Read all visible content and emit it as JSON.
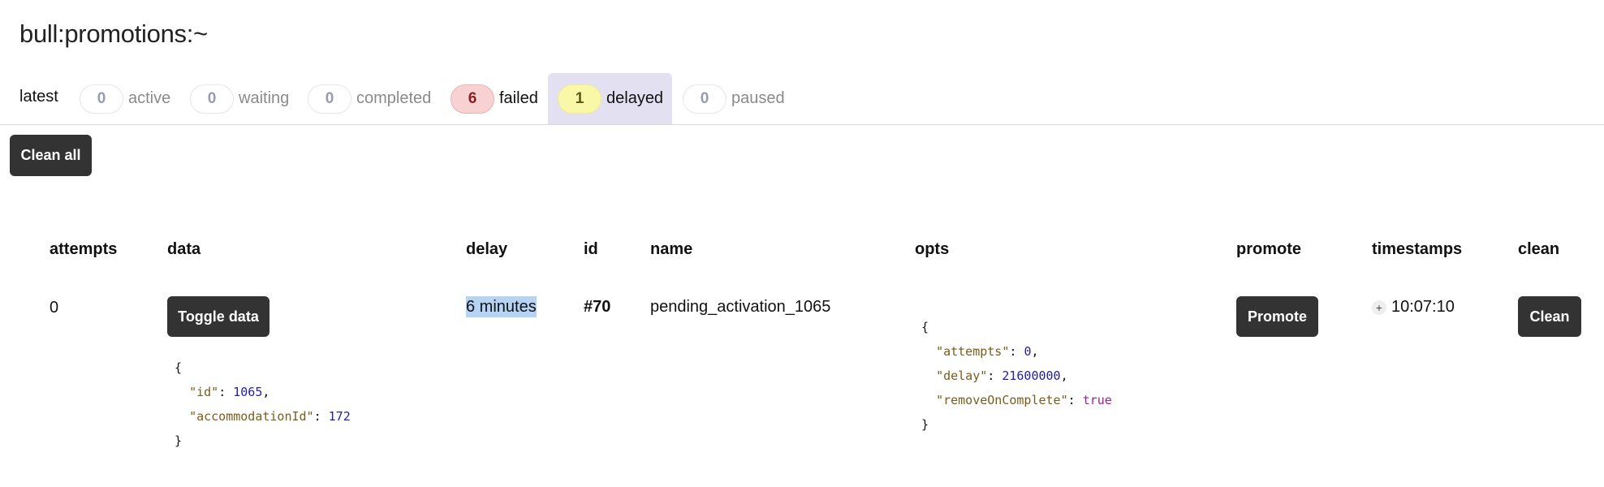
{
  "queue": {
    "title": "bull:promotions:~"
  },
  "tabs": {
    "latest": "latest",
    "active": {
      "count": "0",
      "label": "active"
    },
    "waiting": {
      "count": "0",
      "label": "waiting"
    },
    "completed": {
      "count": "0",
      "label": "completed"
    },
    "failed": {
      "count": "6",
      "label": "failed"
    },
    "delayed": {
      "count": "1",
      "label": "delayed"
    },
    "paused": {
      "count": "0",
      "label": "paused"
    }
  },
  "actions": {
    "clean_all": "Clean all"
  },
  "table": {
    "headers": {
      "attempts": "attempts",
      "data": "data",
      "delay": "delay",
      "id": "id",
      "name": "name",
      "opts": "opts",
      "promote": "promote",
      "timestamps": "timestamps",
      "clean": "clean"
    },
    "row": {
      "attempts": "0",
      "toggle_data": "Toggle data",
      "delay": "6 minutes",
      "id": "#70",
      "name": "pending_activation_1065",
      "promote": "Promote",
      "timestamp_toggle": "+",
      "timestamp": "10:07:10",
      "clean": "Clean",
      "data_json": {
        "open": "{",
        "k1": "\"id\"",
        "v1": "1065",
        "k2": "\"accommodationId\"",
        "v2": "172",
        "close": "}"
      },
      "opts_json": {
        "open": "{",
        "k1": "\"attempts\"",
        "v1": "0",
        "k2": "\"delay\"",
        "v2": "21600000",
        "k3": "\"removeOnComplete\"",
        "v3": "true",
        "close": "}"
      }
    }
  },
  "colors": {
    "button_bg": "#333333",
    "active_tab_bg": "#e2e0f1",
    "failed_badge_bg": "#f8d2d2",
    "delayed_badge_bg": "#f9f7a8",
    "selection_highlight": "#b4d3f5"
  }
}
